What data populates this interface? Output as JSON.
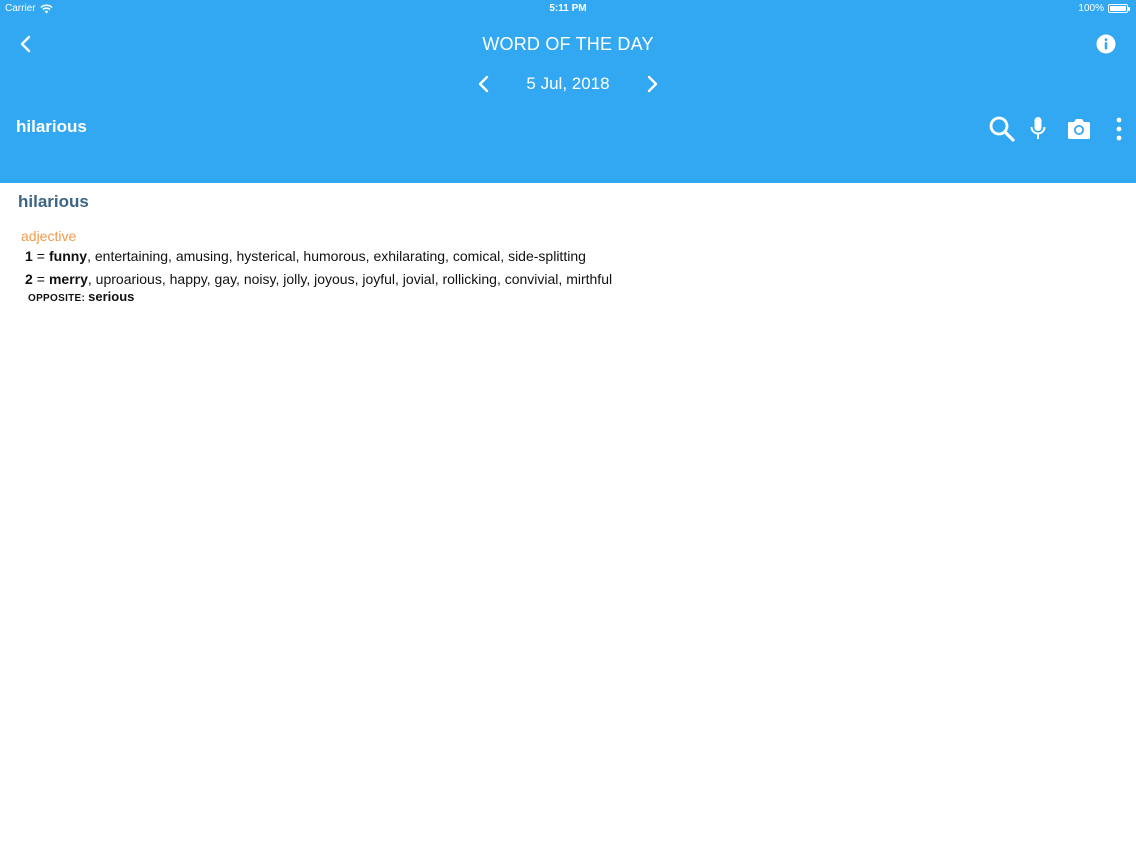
{
  "status_bar": {
    "carrier": "Carrier",
    "time": "5:11 PM",
    "battery": "100%",
    "battery_level": 1.0
  },
  "nav": {
    "title": "WORD OF THE DAY",
    "back_icon": "chevron-left-icon",
    "info_icon": "info-icon"
  },
  "date_nav": {
    "date": "5 Jul, 2018",
    "prev_icon": "chevron-left-icon",
    "next_icon": "chevron-right-icon"
  },
  "search_bar": {
    "word": "hilarious",
    "icons": [
      "search-icon",
      "microphone-icon",
      "camera-icon",
      "more-vertical-icon"
    ]
  },
  "entry": {
    "headword": "hilarious",
    "part_of_speech": "adjective",
    "senses": [
      {
        "number": "1",
        "equals": "=",
        "main": "funny",
        "rest": ", entertaining, amusing, hysterical, humorous, exhilarating, comical, side-splitting"
      },
      {
        "number": "2",
        "equals": "=",
        "main": "merry",
        "rest": ", uproarious, happy, gay, noisy, jolly, joyous, joyful, jovial, rollicking, convivial, mirthful"
      }
    ],
    "opposite_label": "OPPOSITE:",
    "opposite_word": "serious"
  },
  "colors": {
    "header": "#33a8f2",
    "headword": "#3c6484",
    "part_of_speech": "#f29a4a",
    "text": "#111111",
    "background": "#ffffff"
  }
}
